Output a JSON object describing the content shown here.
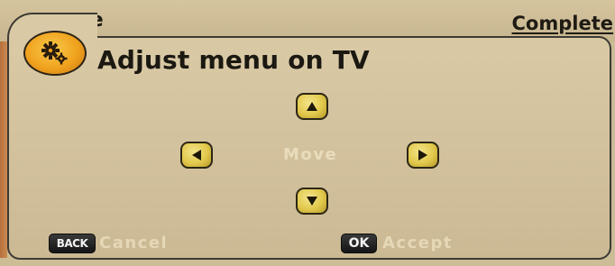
{
  "background": {
    "header_left_text": "ge",
    "header_right_text": "Complete"
  },
  "dialog": {
    "icon": "gear-icon",
    "title": "Adjust menu on TV",
    "move_label": "Move",
    "arrows": [
      "arrow-up-icon",
      "arrow-left-icon",
      "arrow-right-icon",
      "arrow-down-icon"
    ]
  },
  "footer": {
    "back_key": "BACK",
    "cancel_label": "Cancel",
    "ok_key": "OK",
    "accept_label": "Accept"
  },
  "colors": {
    "panel": "#d5c59f",
    "arrow_key": "#e2c94c",
    "icon_badge": "#f0a21e",
    "hint_text": "#e6d8b6"
  }
}
